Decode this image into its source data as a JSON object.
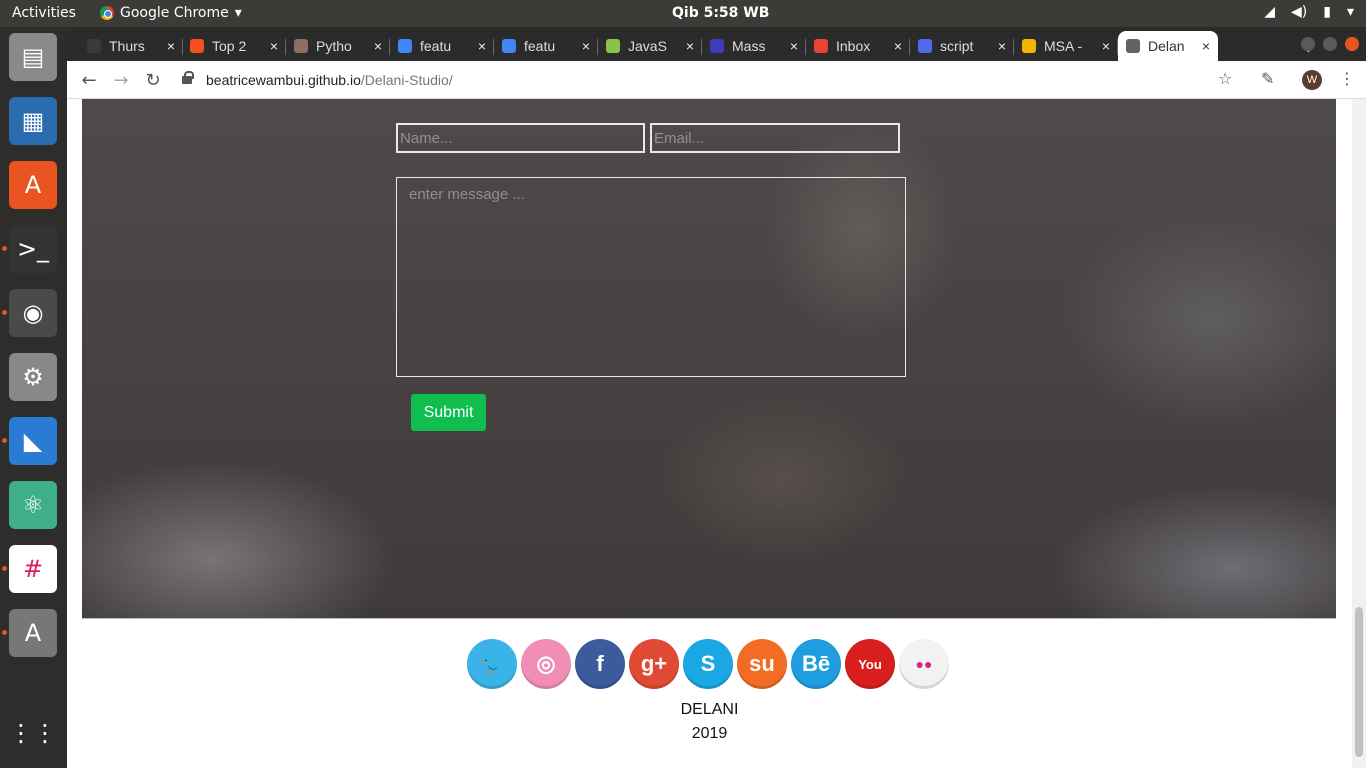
{
  "topbar": {
    "activities": "Activities",
    "app_name": "Google Chrome",
    "clock": "Qib  5:58 WB",
    "tray": {
      "network": "wifi-icon",
      "sound": "speaker-icon",
      "battery": "battery-icon",
      "menu": "chevron-down-icon"
    }
  },
  "dock": {
    "items": [
      {
        "name": "files",
        "icon": "file-cabinet-icon",
        "running": false
      },
      {
        "name": "writer",
        "icon": "document-icon",
        "running": false
      },
      {
        "name": "software",
        "icon": "shopping-bag-icon",
        "running": false
      },
      {
        "name": "terminal",
        "icon": "terminal-icon",
        "running": true
      },
      {
        "name": "chrome",
        "icon": "chrome-icon",
        "running": true
      },
      {
        "name": "settings",
        "icon": "wrench-icon",
        "running": false
      },
      {
        "name": "vscode",
        "icon": "vscode-icon",
        "running": true
      },
      {
        "name": "atom",
        "icon": "atom-icon",
        "running": false
      },
      {
        "name": "slack",
        "icon": "slack-icon",
        "running": true
      },
      {
        "name": "updater",
        "icon": "update-icon",
        "running": true
      },
      {
        "name": "apps",
        "icon": "grid-icon",
        "running": false
      }
    ]
  },
  "browser": {
    "tabs": [
      {
        "title": "Thurs",
        "favicon_color": "#3a3a3a"
      },
      {
        "title": "Top 2",
        "favicon_color": "#f4511e"
      },
      {
        "title": "Pytho",
        "favicon_color": "#8d6e63"
      },
      {
        "title": "featu",
        "favicon_color": "#4285f4"
      },
      {
        "title": "featu",
        "favicon_color": "#4285f4"
      },
      {
        "title": "JavaS",
        "favicon_color": "#8bc34a"
      },
      {
        "title": "Mass",
        "favicon_color": "#3f3bbd"
      },
      {
        "title": "Inbox",
        "favicon_color": "#ea4335"
      },
      {
        "title": "script",
        "favicon_color": "#4f6bed"
      },
      {
        "title": "MSA -",
        "favicon_color": "#f4b400"
      },
      {
        "title": "Delan",
        "favicon_color": "#5f6368",
        "active": true
      }
    ],
    "close_glyph": "×",
    "new_tab_glyph": "+",
    "url_host": "beatricewambui.github.io",
    "url_path": "/Delani-Studio/",
    "profile_initial": "W"
  },
  "form": {
    "name_placeholder": "Name...",
    "email_placeholder": "Email...",
    "message_placeholder": "enter message ...",
    "submit_label": "Submit"
  },
  "social": [
    {
      "name": "twitter",
      "label": "🐦",
      "color": "#3ab3e8"
    },
    {
      "name": "dribbble",
      "label": "◎",
      "color": "#f08eb5"
    },
    {
      "name": "facebook",
      "label": "f",
      "color": "#3b5b9c"
    },
    {
      "name": "google-plus",
      "label": "g+",
      "color": "#e04a35"
    },
    {
      "name": "skype",
      "label": "S",
      "color": "#1ba7e3"
    },
    {
      "name": "stumbleupon",
      "label": "su",
      "color": "#f36c24"
    },
    {
      "name": "behance",
      "label": "Bē",
      "color": "#1f9de0"
    },
    {
      "name": "youtube",
      "label": "You",
      "color": "#d91e1e"
    },
    {
      "name": "flickr",
      "label": "●●",
      "color": "#f2f2f2"
    }
  ],
  "footer": {
    "brand": "DELANI",
    "year": "2019"
  }
}
